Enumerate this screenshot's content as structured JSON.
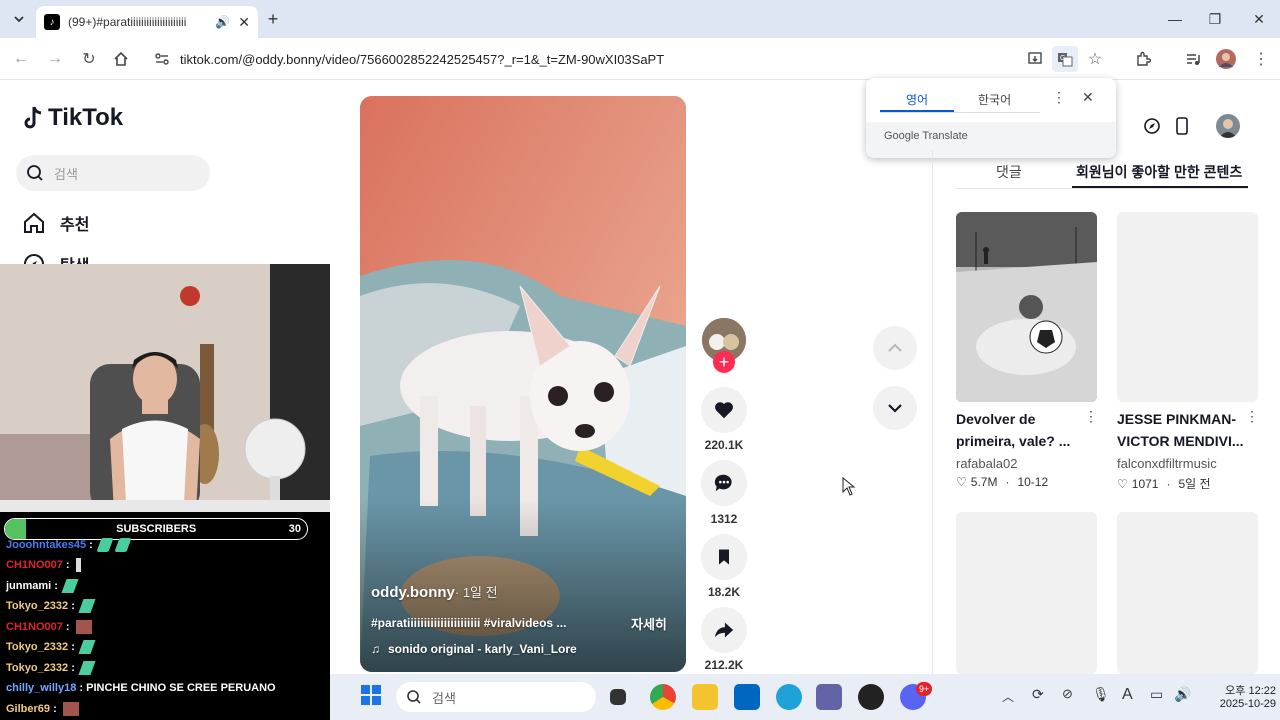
{
  "browser": {
    "tab_title": "(99+)#paratiiiiiiiiiiiiiiiiiiiii",
    "new_tab": "+",
    "url": "tiktok.com/@oddy.bonny/video/7566002852242525457?_r=1&_t=ZM-90wXI03SaPT"
  },
  "translate_popup": {
    "lang_english": "영어",
    "lang_korean": "한국어",
    "brand": "Google Translate"
  },
  "sidebar": {
    "logo": "TikTok",
    "search_placeholder": "검색",
    "items": [
      {
        "label": "추천",
        "icon": "home-icon"
      },
      {
        "label": "탐색",
        "icon": "compass-icon"
      }
    ]
  },
  "stream_overlay": {
    "subscribers_label": "SUBSCRIBERS",
    "subscribers_count": "30",
    "subscribers_progress": 0.07,
    "chat": [
      {
        "user": "Jooohntakes45",
        "text": "",
        "color": "#4a7df0"
      },
      {
        "user": "CH1NO007",
        "text": "",
        "color": "#e0242c"
      },
      {
        "user": "junmami",
        "text": "",
        "color": "#ffffff"
      },
      {
        "user": "Tokyo_2332",
        "text": "",
        "color": "#f2cc7a"
      },
      {
        "user": "CH1NO007",
        "text": "",
        "color": "#e0242c"
      },
      {
        "user": "Tokyo_2332",
        "text": "",
        "color": "#f2cc7a"
      },
      {
        "user": "Tokyo_2332",
        "text": "",
        "color": "#f2cc7a"
      },
      {
        "user": "chilly_willy18",
        "text": "PINCHE CHINO SE CREE PERUANO",
        "color": "#6fa8ff"
      },
      {
        "user": "Gilber69",
        "text": "",
        "color": "#f2cc7a"
      }
    ]
  },
  "video": {
    "author": "oddy.bonny",
    "time": "· 1일 전",
    "caption": "#paratiiiiiiiiiiiiiiiiiiiiii #viralvideos ...",
    "more": "자세히",
    "sound": "sonido original - karly_Vani_Lore"
  },
  "actions": {
    "likes": "220.1K",
    "comments": "1312",
    "saves": "18.2K",
    "shares": "212.2K"
  },
  "panel": {
    "tab_comments": "댓글",
    "tab_recommended": "회원님이 좋아할 만한 콘텐츠",
    "cards": [
      {
        "title": "Devolver de primeira, vale? ...",
        "author": "rafabala02",
        "likes": "5.7M",
        "date": "10-12"
      },
      {
        "title": "JESSE PINKMAN- VICTOR MENDIVI...",
        "author": "falconxdfiltrmusic",
        "likes": "1071",
        "date": "5일 전"
      }
    ]
  },
  "taskbar": {
    "search_placeholder": "검색",
    "time": "오후 12:22",
    "date": "2025-10-29",
    "badge": "9+"
  },
  "colors": {
    "tiktok_pink": "#fe2c55",
    "tab_bar": "#dfe6f3",
    "chrome_accent": "#0b57d0"
  }
}
